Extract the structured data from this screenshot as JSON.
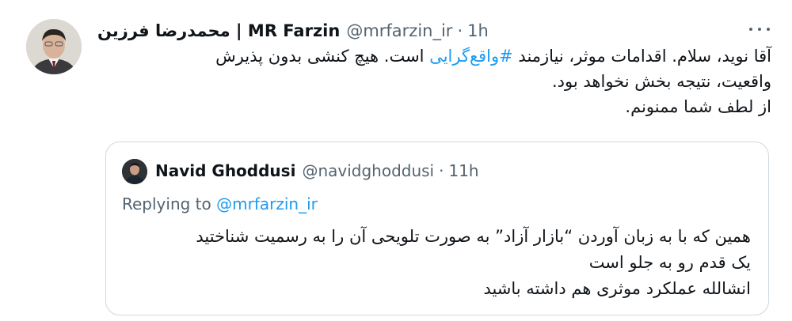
{
  "tweet": {
    "author_name": "محمدرضا فرزین | MR Farzin",
    "handle": "@mrfarzin_ir",
    "separator": "·",
    "time": "1h",
    "more_icon": "more-horizontal-icon",
    "body": {
      "line1_before": "آقا نوید، سلام. اقدامات موثر، نیازمند ",
      "hashtag": "#واقع‌گرایی",
      "line1_after": " است. هیچ کنشی بدون پذیرش",
      "line2": "واقعیت، نتیجه بخش نخواهد بود.",
      "line3": "از لطف شما ممنونم."
    }
  },
  "quote": {
    "author_name": "Navid Ghoddusi",
    "handle": "@navidghoddusi",
    "separator": "·",
    "time": "11h",
    "replying_prefix": "Replying to",
    "replying_handle": "@mrfarzin_ir",
    "body": {
      "line1": "همین که با به زبان آوردن “بازار آزاد” به صورت تلویحی آن را به رسمیت شناختید",
      "line2": "یک قدم رو به جلو است",
      "line3": "انشالله عملکرد موثری هم داشته باشید"
    }
  },
  "colors": {
    "text": "#0f1419",
    "secondary": "#536471",
    "link": "#1d9bf0",
    "border": "#cfd9de"
  }
}
